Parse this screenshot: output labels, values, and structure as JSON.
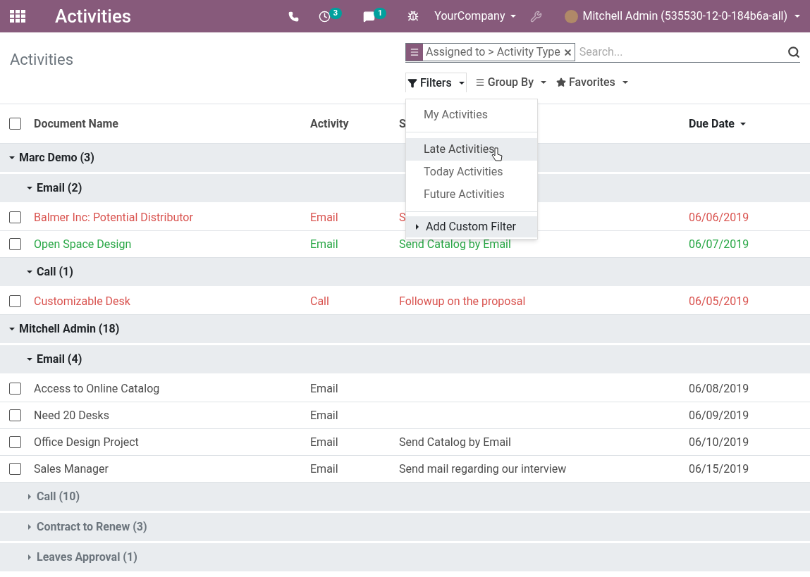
{
  "navbar": {
    "app_title": "Activities",
    "activity_count": "3",
    "message_count": "1",
    "company": "YourCompany",
    "user": "Mitchell Admin (535530-12-0-184b6a-all)"
  },
  "breadcrumb": "Activities",
  "search": {
    "facet": "Assigned to > Activity Type",
    "placeholder": "Search..."
  },
  "search_options": [
    {
      "label": "Filters",
      "open": true
    },
    {
      "label": "Group By",
      "open": false
    },
    {
      "label": "Favorites",
      "open": false
    }
  ],
  "filters_menu": {
    "sections": [
      [
        {
          "label": "My Activities",
          "hovered": false
        }
      ],
      [
        {
          "label": "Late Activities",
          "hovered": true
        },
        {
          "label": "Today Activities",
          "hovered": false
        },
        {
          "label": "Future Activities",
          "hovered": false
        }
      ]
    ],
    "custom": "Add Custom Filter"
  },
  "table": {
    "select_all_checked": false,
    "columns": [
      {
        "label": "Document Name",
        "sorted": false
      },
      {
        "label": "Activity",
        "sorted": false
      },
      {
        "label": "S",
        "sorted": false
      },
      {
        "label": "Due Date",
        "sorted": true
      }
    ],
    "groups": [
      {
        "label": "Marc Demo (3)",
        "expanded": true,
        "children": [
          {
            "label": "Email (2)",
            "expanded": true,
            "rows": [
              {
                "document": "Balmer Inc: Potential Distributor",
                "activity": "Email",
                "summary": "S",
                "due": "06/06/2019",
                "color": "#d9534f",
                "checked": false
              },
              {
                "document": "Open Space Design",
                "activity": "Email",
                "summary": "Send Catalog by Email",
                "due": "06/07/2019",
                "color": "#28a745",
                "checked": false
              }
            ]
          },
          {
            "label": "Call (1)",
            "expanded": true,
            "rows": [
              {
                "document": "Customizable Desk",
                "activity": "Call",
                "summary": "Followup on the proposal",
                "due": "06/05/2019",
                "color": "#d9534f",
                "checked": false
              }
            ]
          }
        ]
      },
      {
        "label": "Mitchell Admin (18)",
        "expanded": true,
        "children": [
          {
            "label": "Email (4)",
            "expanded": true,
            "rows": [
              {
                "document": "Access to Online Catalog",
                "activity": "Email",
                "due": "06/08/2019",
                "color": "#4c4c4c",
                "checked": false
              },
              {
                "document": "Need 20 Desks",
                "activity": "Email",
                "due": "06/09/2019",
                "color": "#4c4c4c",
                "checked": false
              },
              {
                "document": "Office Design Project",
                "activity": "Email",
                "summary": "Send Catalog by Email",
                "due": "06/10/2019",
                "color": "#4c4c4c",
                "checked": false
              },
              {
                "document": "Sales Manager",
                "activity": "Email",
                "summary": "Send mail regarding our interview",
                "due": "06/15/2019",
                "color": "#4c4c4c",
                "checked": false
              }
            ]
          },
          {
            "label": "Call (10)",
            "expanded": false
          },
          {
            "label": "Contract to Renew (3)",
            "expanded": false
          },
          {
            "label": "Leaves Approval (1)",
            "expanded": false
          }
        ]
      }
    ]
  }
}
